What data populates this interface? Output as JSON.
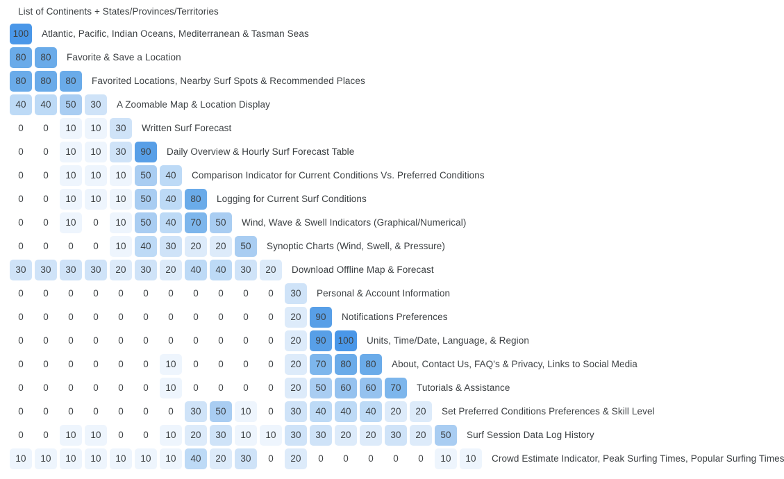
{
  "header": {
    "title": "List of Continents + States/Provinces/Territories"
  },
  "legend": {
    "accent_max": "#4a97e8",
    "accent_min": "#eef5fd",
    "text_color": "#3c4043",
    "background": "#ffffff"
  },
  "chart_data": {
    "type": "heatmap",
    "title": "List of Continents + States/Provinces/Territories",
    "xlabel": "",
    "ylabel": "",
    "grid": false,
    "legend_position": "none",
    "value_range": [
      0,
      100
    ],
    "shape": "lower-triangular",
    "cell_value_step": 10,
    "color_scale": {
      "0": "transparent",
      "10": "#eef5fd",
      "20": "#ddebfa",
      "30": "#cfe3f8",
      "40": "#bddaf6",
      "50": "#a9cdf2",
      "60": "#95c2ef",
      "70": "#7db6ec",
      "80": "#6aabe9",
      "90": "#589fe7",
      "100": "#4a97e8"
    },
    "rows": [
      {
        "label": "Atlantic, Pacific, Indian Oceans, Mediterranean & Tasman Seas",
        "values": [
          100
        ]
      },
      {
        "label": "Favorite & Save a Location",
        "values": [
          80,
          80
        ]
      },
      {
        "label": "Favorited Locations, Nearby Surf Spots & Recommended Places",
        "values": [
          80,
          80,
          80
        ]
      },
      {
        "label": "A Zoomable Map & Location Display",
        "values": [
          40,
          40,
          50,
          30
        ]
      },
      {
        "label": "Written Surf Forecast",
        "values": [
          0,
          0,
          10,
          10,
          30
        ]
      },
      {
        "label": "Daily Overview & Hourly Surf Forecast Table",
        "values": [
          0,
          0,
          10,
          10,
          30,
          90
        ]
      },
      {
        "label": "Comparison Indicator for Current Conditions Vs. Preferred Conditions",
        "values": [
          0,
          0,
          10,
          10,
          10,
          50,
          40
        ]
      },
      {
        "label": "Logging for Current Surf Conditions",
        "values": [
          0,
          0,
          10,
          10,
          10,
          50,
          40,
          80
        ]
      },
      {
        "label": "Wind, Wave & Swell Indicators (Graphical/Numerical)",
        "values": [
          0,
          0,
          10,
          0,
          10,
          50,
          40,
          70,
          50
        ]
      },
      {
        "label": "Synoptic Charts (Wind, Swell, & Pressure)",
        "values": [
          0,
          0,
          0,
          0,
          10,
          40,
          30,
          20,
          20,
          50
        ]
      },
      {
        "label": "Download Offline Map & Forecast",
        "values": [
          30,
          30,
          30,
          30,
          20,
          30,
          20,
          40,
          40,
          30,
          20
        ]
      },
      {
        "label": "Personal & Account Information",
        "values": [
          0,
          0,
          0,
          0,
          0,
          0,
          0,
          0,
          0,
          0,
          0,
          30
        ]
      },
      {
        "label": "Notifications Preferences",
        "values": [
          0,
          0,
          0,
          0,
          0,
          0,
          0,
          0,
          0,
          0,
          0,
          20,
          90
        ]
      },
      {
        "label": "Units, Time/Date, Language, & Region",
        "values": [
          0,
          0,
          0,
          0,
          0,
          0,
          0,
          0,
          0,
          0,
          0,
          20,
          90,
          100
        ]
      },
      {
        "label": "About, Contact Us, FAQ's & Privacy, Links to Social Media",
        "values": [
          0,
          0,
          0,
          0,
          0,
          0,
          10,
          0,
          0,
          0,
          0,
          20,
          70,
          80,
          80
        ]
      },
      {
        "label": "Tutorials & Assistance",
        "values": [
          0,
          0,
          0,
          0,
          0,
          0,
          10,
          0,
          0,
          0,
          0,
          20,
          50,
          60,
          60,
          70
        ]
      },
      {
        "label": "Set Preferred Conditions Preferences & Skill Level",
        "values": [
          0,
          0,
          0,
          0,
          0,
          0,
          0,
          30,
          50,
          10,
          0,
          30,
          40,
          40,
          40,
          20,
          20
        ]
      },
      {
        "label": "Surf Session Data Log History",
        "values": [
          0,
          0,
          10,
          10,
          0,
          0,
          10,
          20,
          30,
          10,
          10,
          30,
          30,
          20,
          20,
          30,
          20,
          50
        ]
      },
      {
        "label": "Crowd Estimate Indicator, Peak Surfing Times, Popular Surfing Times",
        "values": [
          10,
          10,
          10,
          10,
          10,
          10,
          10,
          40,
          20,
          30,
          0,
          20,
          0,
          0,
          0,
          0,
          0,
          10,
          10
        ]
      }
    ]
  }
}
